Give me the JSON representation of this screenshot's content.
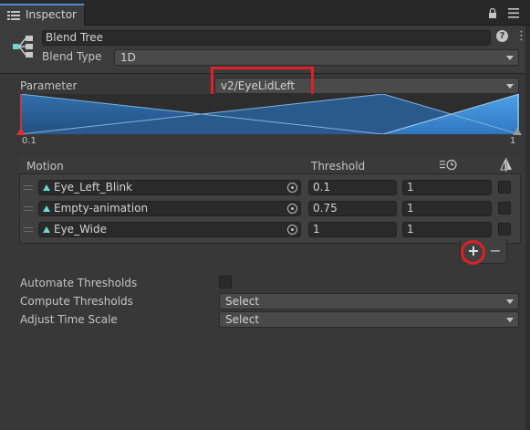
{
  "window": {
    "tab_title": "Inspector"
  },
  "header": {
    "name": "Blend Tree",
    "blend_type_label": "Blend Type",
    "blend_type_value": "1D"
  },
  "parameter": {
    "label": "Parameter",
    "value": "v2/EyeLidLeft",
    "range_min": "0.1",
    "range_max": "1"
  },
  "motion_table": {
    "headers": {
      "motion": "Motion",
      "threshold": "Threshold"
    },
    "rows": [
      {
        "motion": "Eye_Left_Blink",
        "threshold": "0.1",
        "time_scale": "1"
      },
      {
        "motion": "Empty-animation",
        "threshold": "0.75",
        "time_scale": "1"
      },
      {
        "motion": "Eye_Wide",
        "threshold": "1",
        "time_scale": "1"
      }
    ],
    "add_label": "+",
    "remove_label": "−"
  },
  "settings": {
    "automate_label": "Automate Thresholds",
    "compute_label": "Compute Thresholds",
    "compute_value": "Select",
    "adjust_label": "Adjust Time Scale",
    "adjust_value": "Select"
  },
  "colors": {
    "highlight": "#e01f26",
    "accent_blue": "#3f8fd6",
    "clip_teal": "#6fd6c9"
  },
  "icons": [
    "inspector-icon",
    "lock-icon",
    "menu-icon",
    "blend-tree-icon",
    "help-icon",
    "kebab-icon",
    "time-scale-icon",
    "mirror-icon",
    "object-picker-icon"
  ]
}
